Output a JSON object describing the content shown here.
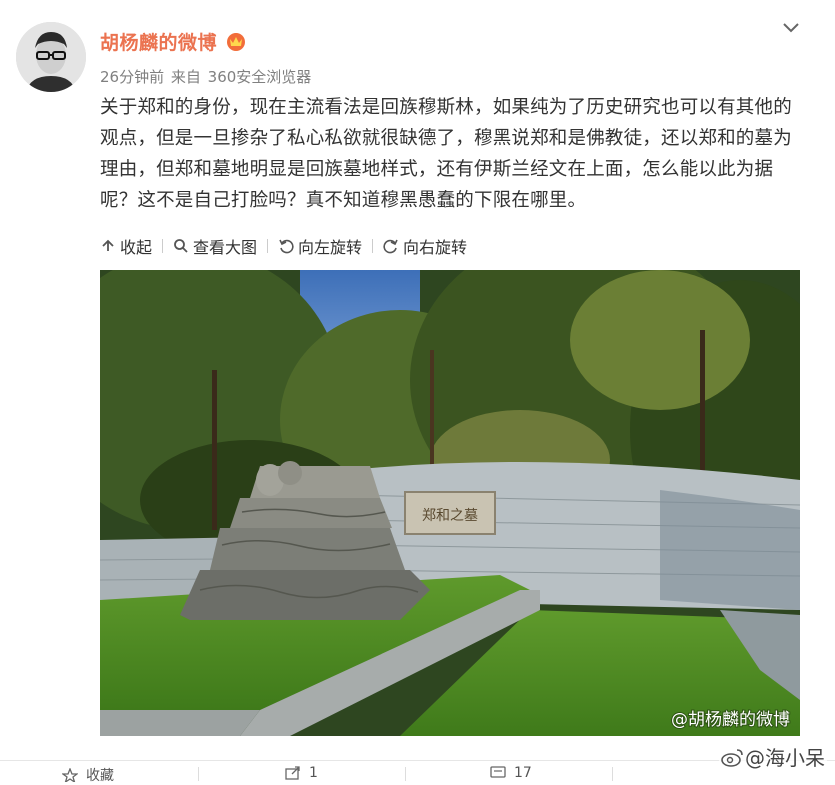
{
  "post": {
    "author": "胡杨麟的微博",
    "time": "26分钟前",
    "source_prefix": "来自",
    "source": "360安全浏览器",
    "text": "关于郑和的身份，现在主流看法是回族穆斯林，如果纯为了历史研究也可以有其他的观点，但是一旦掺杂了私心私欲就很缺德了，穆黑说郑和是佛教徒，还以郑和的墓为理由，但郑和墓地明显是回族墓地样式，还有伊斯兰经文在上面，怎么能以此为据呢？这不是自己打脸吗？真不知道穆黑愚蠢的下限在哪里。"
  },
  "image_actions": [
    {
      "label": "收起",
      "icon": "collapse-icon"
    },
    {
      "label": "查看大图",
      "icon": "magnifier-icon"
    },
    {
      "label": "向左旋转",
      "icon": "rotate-left-icon"
    },
    {
      "label": "向右旋转",
      "icon": "rotate-right-icon"
    }
  ],
  "photo": {
    "watermark": "@胡杨麟的微博",
    "plaque_text": "郑和之墓"
  },
  "footer": {
    "favorite": "收藏",
    "repost_count": "1",
    "comment_count": "17"
  },
  "corner_watermark": "@海小呆",
  "colors": {
    "author": "#eb7350",
    "meta": "#808080",
    "text": "#333333"
  }
}
